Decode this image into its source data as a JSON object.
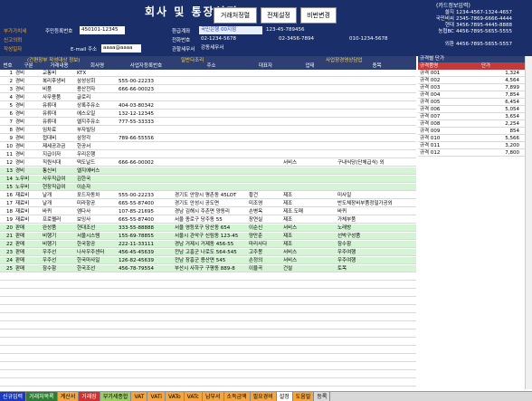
{
  "app": {
    "title": "회사 및 통장설정",
    "card_info_title": "(카드정보입력)"
  },
  "toolbar": {
    "btn1": "거래처정렬",
    "btn2": "전체설정",
    "btn3": "비번변경"
  },
  "company": {
    "vat_label": "부가가치세",
    "vat_sub1": "신고의뢰",
    "vat_sub2": "작성일자",
    "reg_label": "주민등록번호",
    "reg_value": "450101-12345",
    "email_label": "E-mail 주소",
    "email_value": "aaaa@aaaa",
    "refund_label": "환급계좌",
    "refund_value": "국민은행 00지점",
    "refund_no": "123-45-789456",
    "phone_label": "전화번호",
    "phone1": "02-1234-5678",
    "phone2": "02-3456-7894",
    "phone3": "010-1234-5678",
    "tax_office_label": "관할세무서",
    "tax_office_value": "강동세무서"
  },
  "cards": [
    {
      "name": "쓸지",
      "no": "1234-4567-1324-4657"
    },
    {
      "name": "국민비씨",
      "no": "2345-7869-6666-4444"
    },
    {
      "name": "현대",
      "no": "3456-7895-4445-8888"
    },
    {
      "name": "농협BC",
      "no": "4456-7895-5655-5555"
    },
    {
      "name": "외환",
      "no": "4456-7895-5655-5557"
    }
  ],
  "band_text": "(간편장부 작성대상 정보)",
  "band_text2": "일반다조리",
  "band_text3": "사업장경영상담업",
  "columns": [
    "번호",
    "구분",
    "거래내용",
    "회사명",
    "사업자등록번호",
    "주소",
    "대표자",
    "업태",
    "종목"
  ],
  "rows": [
    [
      "1",
      "경비",
      "교통비",
      "KTX",
      "",
      "",
      "",
      "",
      ""
    ],
    [
      "2",
      "경비",
      "복리후생비",
      "삼성상회",
      "555-00-22233",
      "",
      "",
      "",
      ""
    ],
    [
      "3",
      "경비",
      "비품",
      "용산전자",
      "666-66-00023",
      "",
      "",
      "",
      ""
    ],
    [
      "4",
      "경비",
      "사무용품",
      "글로리",
      "",
      "",
      "",
      "",
      ""
    ],
    [
      "5",
      "경비",
      "유류대",
      "상록주유소",
      "404-03-80342",
      "",
      "",
      "",
      ""
    ],
    [
      "6",
      "경비",
      "유류대",
      "에스오일",
      "132-12-12345",
      "",
      "",
      "",
      ""
    ],
    [
      "7",
      "경비",
      "유류대",
      "엘지주유소",
      "777-55-33333",
      "",
      "",
      "",
      ""
    ],
    [
      "8",
      "경비",
      "임차료",
      "부자빌딩",
      "",
      "",
      "",
      "",
      ""
    ],
    [
      "9",
      "경비",
      "접대비",
      "삼정각",
      "789-66-55556",
      "",
      "",
      "",
      ""
    ],
    [
      "10",
      "경비",
      "제세공과금",
      "한공서",
      "",
      "",
      "",
      "",
      ""
    ],
    [
      "11",
      "경비",
      "지급이자",
      "우리은행",
      "",
      "",
      "",
      "",
      ""
    ],
    [
      "12",
      "경비",
      "직원식대",
      "떡도날드",
      "666-66-00002",
      "",
      "",
      "서비스",
      "구내식당(단체급식) 외"
    ],
    [
      "13",
      "경비",
      "통신비",
      "엘지에버스",
      "",
      "",
      "",
      "",
      ""
    ],
    [
      "14",
      "노무비",
      "사무직급여",
      "김한국",
      "",
      "",
      "",
      "",
      ""
    ],
    [
      "15",
      "노무비",
      "현장직급여",
      "이순자",
      "",
      "",
      "",
      "",
      ""
    ],
    [
      "16",
      "재료비",
      "날개",
      "포드자동차",
      "555-00-22233",
      "경기도 안양시 평촌동 45LOT",
      "황건",
      "제조",
      "미사일"
    ],
    [
      "17",
      "재료비",
      "날개",
      "미라항공",
      "665-55-87400",
      "경기도 안성시 공도면",
      "미조영",
      "제조",
      "반도체장비부품정밀가공외"
    ],
    [
      "18",
      "재료비",
      "바퀴",
      "엠다사",
      "107-85-21695",
      "경남 김해시 주촌면 양동리",
      "손병옥",
      "제조.도매",
      "바퀴"
    ],
    [
      "19",
      "재료비",
      "프로펠러",
      "보잉사",
      "665-55-87400",
      "서울 종로구 당주동 55",
      "장연실",
      "제조",
      "가체부품"
    ],
    [
      "20",
      "판매",
      "완성품",
      "현대조선",
      "333-55-88888",
      "서울 영등포구 당산동 654",
      "이순신",
      "서비스",
      "노래방"
    ],
    [
      "21",
      "판매",
      "비행기",
      "서울시스템",
      "155-69-78855",
      "서울시 관악구 신림동 123-45",
      "양만춘",
      "제조",
      "선박구성품"
    ],
    [
      "22",
      "판매",
      "비행기",
      "한국항공",
      "222-11-33111",
      "경남 거제시 거제동 456-55",
      "마리사다",
      "제조",
      "잠수함"
    ],
    [
      "23",
      "판매",
      "우주선",
      "나사우주센터",
      "456-45-45639",
      "전남 고흥군 나로도 564-545",
      "고주몽",
      "서비스",
      "우주여행"
    ],
    [
      "24",
      "판매",
      "우주선",
      "한국마사일",
      "126-82-45639",
      "전남 장흥군 용산면 545",
      "손정의",
      "서비스",
      "우주여행"
    ],
    [
      "25",
      "판매",
      "잠수함",
      "한국조선",
      "456-78-79554",
      "부산시 사하구 구평동 889-8",
      "이율곡",
      "건설",
      "토목"
    ]
  ],
  "side": {
    "title": "규격별 단가",
    "head_left": "규격품명",
    "head_right": "단가",
    "rows": [
      [
        "규격 001",
        "1,324"
      ],
      [
        "규격 002",
        "4,564"
      ],
      [
        "규격 003",
        "7,899"
      ],
      [
        "규격 004",
        "7,854"
      ],
      [
        "규격 005",
        "6,454"
      ],
      [
        "규격 006",
        "5,054"
      ],
      [
        "규격 007",
        "3,654"
      ],
      [
        "규격 008",
        "2,254"
      ],
      [
        "규격 009",
        "854"
      ],
      [
        "규격 010",
        "5,566"
      ],
      [
        "규격 011",
        "3,200"
      ],
      [
        "규격 012",
        "7,800"
      ]
    ]
  },
  "tabs": [
    {
      "label": "신규입력",
      "color": "#1a3bbf",
      "text": "#ffffff"
    },
    {
      "label": "거래처목록",
      "color": "#2e7d32",
      "text": "#ffffff"
    },
    {
      "label": "계산서",
      "color": "#f2a541",
      "text": "#000000"
    },
    {
      "label": "거래장",
      "color": "#d32f2f",
      "text": "#ffffff"
    },
    {
      "label": "부가세종합",
      "color": "#9ccc65",
      "text": "#000000"
    },
    {
      "label": "VAT",
      "color": "#f2a541",
      "text": "#000000"
    },
    {
      "label": "VATi",
      "color": "#f2a541",
      "text": "#000000"
    },
    {
      "label": "VATo",
      "color": "#f2a541",
      "text": "#000000"
    },
    {
      "label": "VATc",
      "color": "#f2a541",
      "text": "#000000"
    },
    {
      "label": "납부서",
      "color": "#f2a541",
      "text": "#000000"
    },
    {
      "label": "소득금액",
      "color": "#f2a541",
      "text": "#000000"
    },
    {
      "label": "필요경비",
      "color": "#f2a541",
      "text": "#000000"
    },
    {
      "label": "설정",
      "color": "#ffffff",
      "text": "#000000"
    },
    {
      "label": "도움말",
      "color": "#f2a541",
      "text": "#000000"
    },
    {
      "label": "등록",
      "color": "#d8d8d8",
      "text": "#000000"
    }
  ]
}
